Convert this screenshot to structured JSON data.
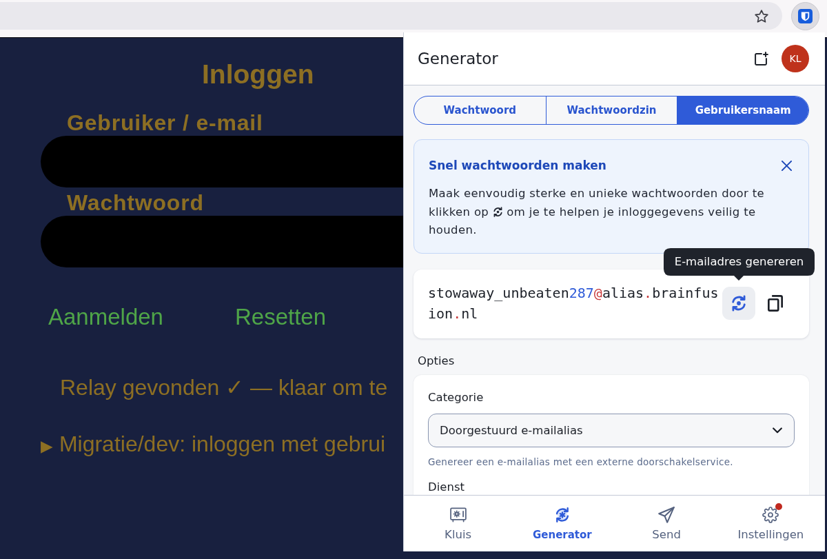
{
  "page": {
    "title": "Inloggen",
    "fields": [
      {
        "label": "Gebruiker / e-mail"
      },
      {
        "label": "Wachtwoord"
      }
    ],
    "actions": [
      "Aanmelden",
      "Resetten"
    ],
    "status": "Relay gevonden ✓ — klaar om te",
    "disclosure": {
      "marker": "▶",
      "summary": "Migratie/dev: inloggen met gebrui"
    }
  },
  "popup": {
    "title": "Generator",
    "avatar": "KL",
    "tabs": [
      {
        "label": "Wachtwoord",
        "selected": false
      },
      {
        "label": "Wachtwoordzin",
        "selected": false
      },
      {
        "label": "Gebruikersnaam",
        "selected": true
      }
    ],
    "callout": {
      "title": "Snel wachtwoorden maken",
      "text_before_icon": "Maak eenvoudig sterke en unieke wachtwoorden door te klikken op",
      "text_after_icon": "om je te helpen je inloggegevens veilig te houden."
    },
    "generated_value": "stowaway_unbeaten287@alias.brainfusion.nl",
    "tooltip": "E-mailadres genereren",
    "options": {
      "heading": "Opties",
      "category": {
        "label": "Categorie",
        "value": "Doorgestuurd e-mailalias",
        "hint": "Genereer een e-mailalias met een externe doorschakelservice."
      },
      "next_label": "Dienst"
    },
    "nav": [
      {
        "label": "Kluis",
        "selected": false,
        "notification": false
      },
      {
        "label": "Generator",
        "selected": true,
        "notification": false
      },
      {
        "label": "Send",
        "selected": false,
        "notification": false
      },
      {
        "label": "Instellingen",
        "selected": false,
        "notification": true
      }
    ]
  }
}
